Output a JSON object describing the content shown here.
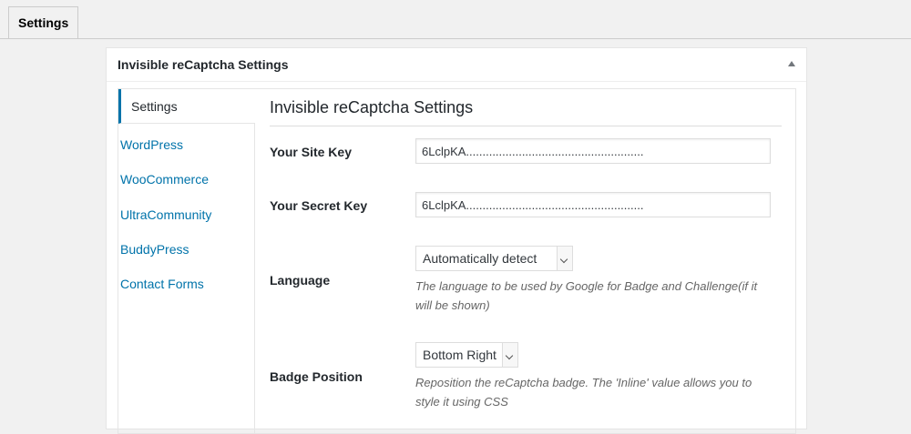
{
  "tabs": [
    {
      "label": "Settings",
      "active": true
    }
  ],
  "postbox": {
    "title": "Invisible reCaptcha Settings"
  },
  "nav": {
    "items": [
      {
        "label": "Settings",
        "active": true
      },
      {
        "label": "WordPress",
        "active": false
      },
      {
        "label": "WooCommerce",
        "active": false
      },
      {
        "label": "UltraCommunity",
        "active": false
      },
      {
        "label": "BuddyPress",
        "active": false
      },
      {
        "label": "Contact Forms",
        "active": false
      }
    ]
  },
  "section": {
    "title": "Invisible reCaptcha Settings"
  },
  "fields": {
    "site_key": {
      "label": "Your Site Key",
      "value": "6LclpKA......................................................"
    },
    "secret_key": {
      "label": "Your Secret Key",
      "value": "6LclpKA......................................................"
    },
    "language": {
      "label": "Language",
      "selected": "Automatically detect",
      "description": "The language to be used by Google for Badge and Challenge(if it will be shown)"
    },
    "badge_position": {
      "label": "Badge Position",
      "selected": "Bottom Right",
      "description": "Reposition the reCaptcha badge. The 'Inline' value allows you to style it using CSS"
    }
  },
  "colors": {
    "link": "#0073aa",
    "background": "#f1f1f1",
    "panel": "#ffffff"
  }
}
